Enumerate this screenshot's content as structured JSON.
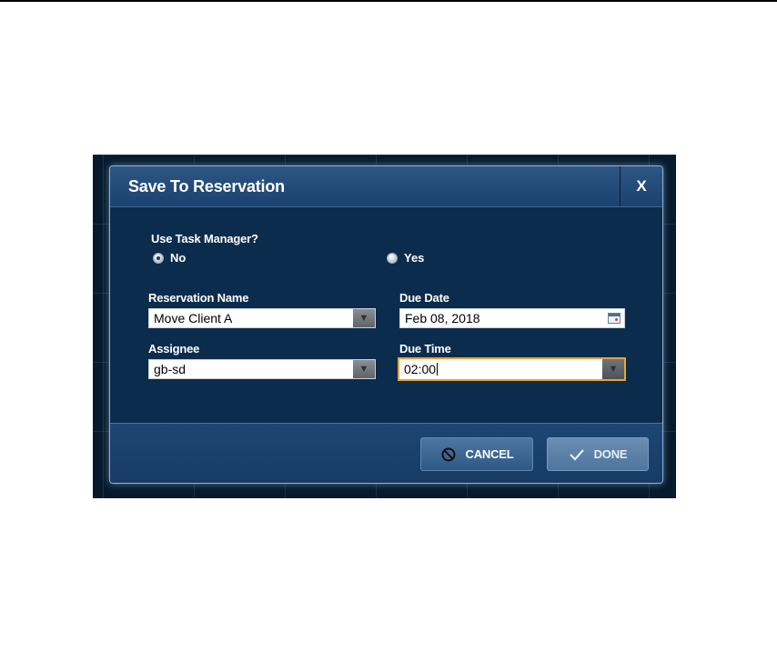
{
  "dialog": {
    "title": "Save To Reservation",
    "close_label": "X"
  },
  "task_manager": {
    "question": "Use Task Manager?",
    "options": [
      {
        "label": "No",
        "selected": true
      },
      {
        "label": "Yes",
        "selected": false
      }
    ]
  },
  "fields": {
    "reservation_name": {
      "label": "Reservation Name",
      "value": "Move Client A"
    },
    "assignee": {
      "label": "Assignee",
      "value": "gb-sd"
    },
    "due_date": {
      "label": "Due Date",
      "value": "Feb 08, 2018"
    },
    "due_time": {
      "label": "Due Time",
      "value": "02:00"
    }
  },
  "buttons": {
    "cancel": "CANCEL",
    "done": "DONE"
  },
  "icons": {
    "dropdown": "chevron-down-icon",
    "calendar": "calendar-icon",
    "cancel": "prohibited-icon",
    "done": "checkmark-icon"
  },
  "colors": {
    "dialog_bg": "#0c2c4e",
    "header_bg": "#1b4270",
    "focus_border": "#e8a23a",
    "button_bg": "#3d6690"
  }
}
